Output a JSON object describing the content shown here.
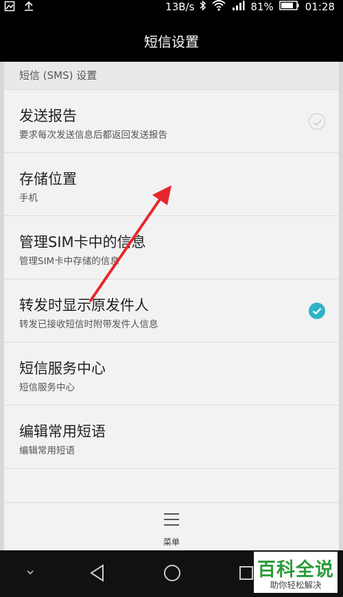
{
  "status_bar": {
    "speed": "13B/s",
    "battery": "81%",
    "time": "01:28",
    "icons": [
      "image-icon",
      "upload-icon",
      "bluetooth-icon",
      "wifi-icon",
      "signal-icon",
      "battery-icon"
    ]
  },
  "title_bar": {
    "title": "短信设置"
  },
  "section": {
    "header": "短信 (SMS) 设置"
  },
  "items": [
    {
      "title": "发送报告",
      "subtitle": "要求每次发送信息后都返回发送报告",
      "checkbox": "unchecked"
    },
    {
      "title": "存储位置",
      "subtitle": "手机"
    },
    {
      "title": "管理SIM卡中的信息",
      "subtitle": "管理SIM卡中存储的信息"
    },
    {
      "title": "转发时显示原发件人",
      "subtitle": "转发已接收短信时附带发件人信息",
      "checkbox": "checked"
    },
    {
      "title": "短信服务中心",
      "subtitle": "短信服务中心"
    },
    {
      "title": "编辑常用短语",
      "subtitle": "编辑常用短语"
    }
  ],
  "menu": {
    "label": "菜单",
    "icon": "menu-icon"
  },
  "nav_bar": {
    "icons": [
      "chevron-down-icon",
      "back-icon",
      "home-icon",
      "recents-icon"
    ]
  },
  "watermark": {
    "main": "百科全说",
    "sub": "助你轻松解决"
  },
  "colors": {
    "accent": "#2fb3c7",
    "arrow": "#e8262b",
    "watermark_green": "#2a9d3a"
  }
}
